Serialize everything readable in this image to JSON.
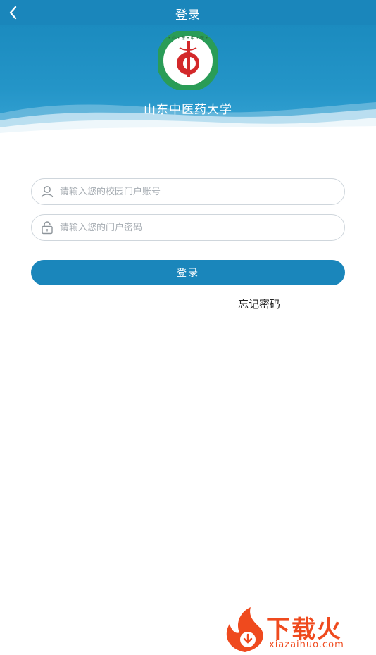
{
  "header": {
    "title": "登录",
    "back_icon": "chevron-left-icon"
  },
  "hero": {
    "university_name": "山东中医药大学",
    "logo_seal_text": "山东中医药大学"
  },
  "form": {
    "account": {
      "placeholder": "请输入您的校园门户账号",
      "value": "",
      "icon": "user-icon"
    },
    "password": {
      "placeholder": "请输入您的门户密码",
      "value": "",
      "icon": "lock-icon"
    },
    "login_label": "登录",
    "forgot_label": "忘记密码"
  },
  "watermark": {
    "brand": "下载火",
    "domain": "xiazaihuo.com"
  },
  "colors": {
    "primary": "#1a86bb",
    "hero": "#2495c8",
    "watermark": "#ef4a1e"
  }
}
